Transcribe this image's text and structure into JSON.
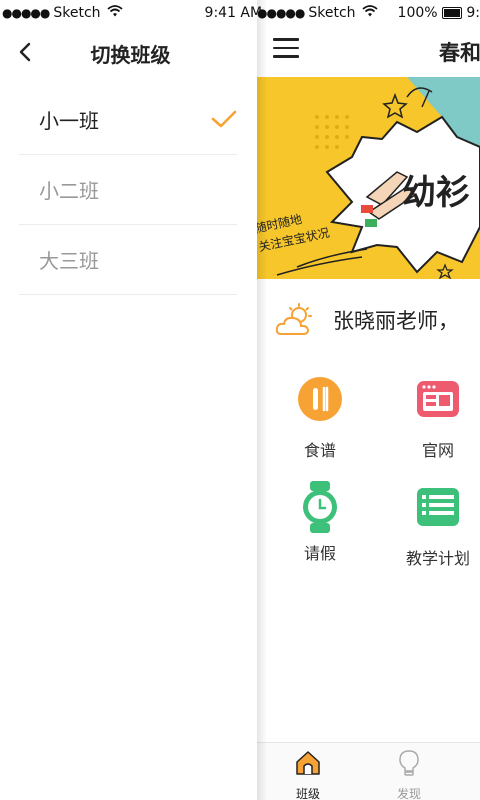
{
  "status_bar_left": {
    "signal": "●●●●●",
    "carrier": "Sketch",
    "wifi": "wifi-icon",
    "time": "9:41 AM"
  },
  "status_bar_right": {
    "signal": "●●●●●",
    "carrier": "Sketch",
    "wifi": "wifi-icon",
    "battery_pct": "100%",
    "time_clipped": "9:"
  },
  "drawer": {
    "title": "切换班级",
    "back_icon": "chevron-left-icon",
    "classes": [
      {
        "label": "小一班",
        "selected": true
      },
      {
        "label": "小二班",
        "selected": false
      },
      {
        "label": "大三班",
        "selected": false
      }
    ],
    "check_color": "#f7a234"
  },
  "app": {
    "title": "春和",
    "menu_icon": "hamburger-icon",
    "banner": {
      "headline": "幼衫",
      "note_line1": "随时随地",
      "note_line2": "关注宝宝状况",
      "bg_color": "#f6c62a"
    },
    "greeting": "张晓丽老师，",
    "grid": [
      {
        "label": "食谱",
        "icon": "cutlery-icon",
        "color": "#f7a234"
      },
      {
        "label": "官网",
        "icon": "website-icon",
        "color": "#ef5b6e"
      },
      {
        "label": "请假",
        "icon": "watch-icon",
        "color": "#3cc07a"
      },
      {
        "label": "教学计划",
        "icon": "list-icon",
        "color": "#3cc07a"
      }
    ],
    "tabs": [
      {
        "label": "班级",
        "icon": "home-icon",
        "active": true
      },
      {
        "label": "发现",
        "icon": "lightbulb-icon",
        "active": false
      }
    ],
    "accent": "#f7a234"
  }
}
